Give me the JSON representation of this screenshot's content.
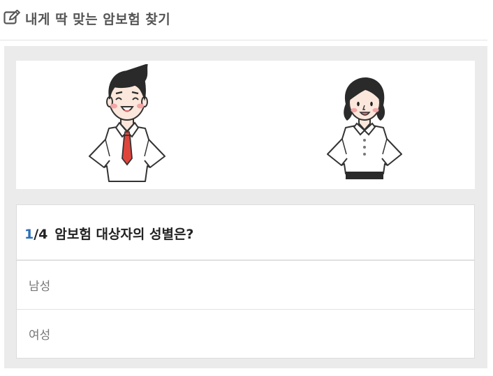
{
  "header": {
    "title": "내게 딱 맞는 암보험 찾기"
  },
  "question": {
    "current": "1",
    "total": "/4",
    "text": "암보험 대상자의 성별은?"
  },
  "options": [
    {
      "label": "남성"
    },
    {
      "label": "여성"
    }
  ]
}
